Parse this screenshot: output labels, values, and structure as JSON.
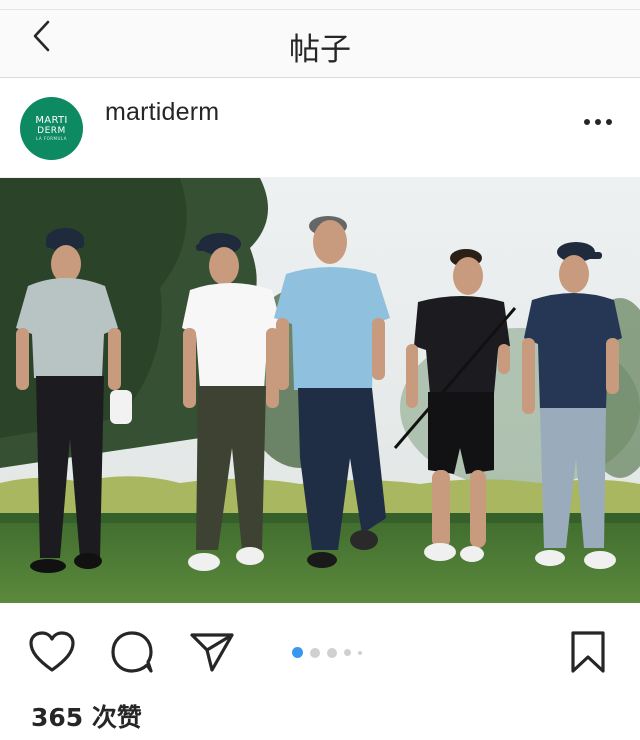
{
  "header": {
    "title": "帖子",
    "back_icon": "chevron-left-icon"
  },
  "post": {
    "username": "martiderm",
    "avatar": {
      "line1": "MARTI",
      "line2": "DERM",
      "line3": "LA FORMULA",
      "color": "#0e8a62"
    },
    "more_icon": "three-dots-icon",
    "image_description_icon": "golf-group-photo",
    "carousel": {
      "count": 5,
      "active_index": 0,
      "active_color": "#3897f0"
    },
    "actions": {
      "like_icon": "heart-icon",
      "comment_icon": "comment-bubble-icon",
      "share_icon": "paper-plane-icon",
      "save_icon": "bookmark-icon"
    },
    "likes_text": "365 次赞"
  }
}
